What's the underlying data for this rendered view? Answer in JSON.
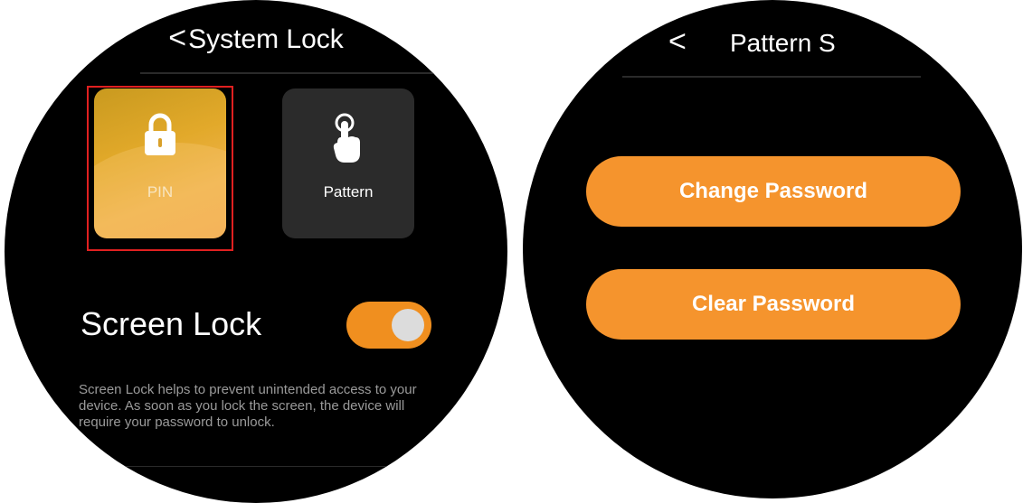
{
  "left_screen": {
    "header": {
      "back_glyph": "<",
      "title": "System Lock"
    },
    "lock_options": [
      {
        "label": "PIN",
        "icon": "padlock-icon",
        "selected": true
      },
      {
        "label": "Pattern",
        "icon": "tap-finger-icon",
        "selected": false
      }
    ],
    "screen_lock": {
      "label": "Screen Lock",
      "enabled": true,
      "description": "Screen Lock helps to prevent unintended access to your device. As soon as you lock the screen, the device will require your password to unlock."
    }
  },
  "right_screen": {
    "header": {
      "back_glyph": "<",
      "title": "Pattern S"
    },
    "buttons": {
      "change_password": "Change Password",
      "clear_password": "Clear Password"
    }
  },
  "colors": {
    "accent_orange": "#f5942d",
    "toggle_on": "#f08f1f",
    "pin_tile": "#e2a92a",
    "pattern_tile": "#2b2b2b",
    "selection_outline": "#e02020",
    "background": "#000000"
  }
}
